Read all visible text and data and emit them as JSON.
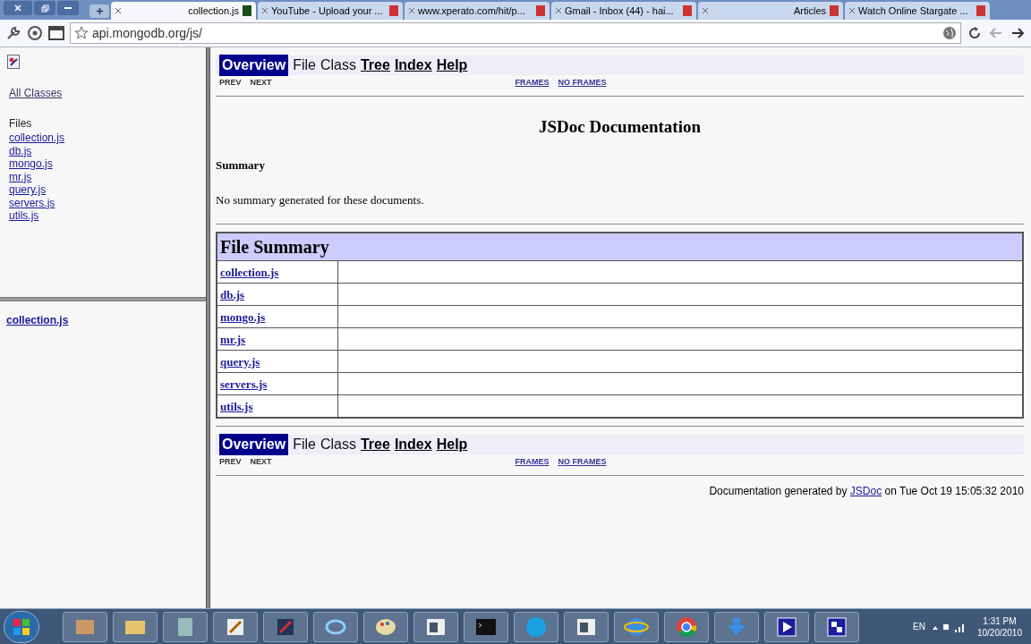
{
  "browser": {
    "tabs": [
      {
        "title": "collection.js",
        "selected": true
      },
      {
        "title": "YouTube - Upload your ...",
        "selected": false
      },
      {
        "title": "www.xperato.com/hit/p...",
        "selected": false
      },
      {
        "title": "Gmail - Inbox (44) - hai...",
        "selected": false
      },
      {
        "title": "Articles",
        "selected": false
      },
      {
        "title": "Watch Online Stargate ...",
        "selected": false
      }
    ],
    "address": "api.mongodb.org/js/"
  },
  "left_frame": {
    "all_classes": "All Classes",
    "files_heading": "Files",
    "files": [
      "collection.js",
      "db.js",
      "mongo.js",
      "mr.js",
      "query.js",
      "servers.js",
      "utils.js"
    ],
    "current_file": "collection.js"
  },
  "nav_bars": [
    {
      "items": [
        {
          "label": "Overview",
          "kind": "current"
        },
        {
          "label": "File",
          "kind": "text"
        },
        {
          "label": "Class",
          "kind": "text"
        },
        {
          "label": "Tree",
          "kind": "link"
        },
        {
          "label": "Index",
          "kind": "link"
        },
        {
          "label": "Help",
          "kind": "link"
        }
      ],
      "prev": "PREV",
      "next": "NEXT",
      "frames": "FRAMES",
      "no_frames": "NO FRAMES"
    },
    {
      "items": [
        {
          "label": "Overview",
          "kind": "current"
        },
        {
          "label": "File",
          "kind": "text"
        },
        {
          "label": "Class",
          "kind": "text"
        },
        {
          "label": "Tree",
          "kind": "link"
        },
        {
          "label": "Index",
          "kind": "link"
        },
        {
          "label": "Help",
          "kind": "link"
        }
      ],
      "prev": "PREV",
      "next": "NEXT",
      "frames": "FRAMES",
      "no_frames": "NO FRAMES"
    }
  ],
  "title": "JSDoc Documentation",
  "summary": {
    "heading": "Summary",
    "text": "No summary generated for these documents."
  },
  "file_summary": {
    "heading": "File Summary",
    "rows": [
      "collection.js",
      "db.js",
      "mongo.js",
      "mr.js",
      "query.js",
      "servers.js",
      "utils.js"
    ]
  },
  "footer": {
    "before": "Documentation generated by",
    "link": "JSDoc",
    "after": "on Tue Oct 19 15:05:32 2010"
  },
  "taskbar": {
    "language": "EN",
    "time": "1:31 PM",
    "date": "10/20/2010"
  }
}
